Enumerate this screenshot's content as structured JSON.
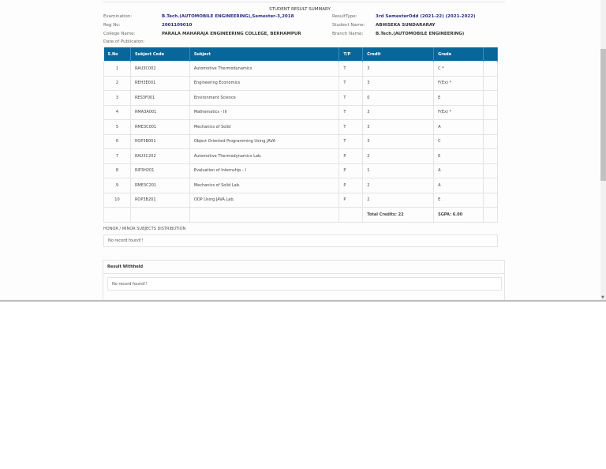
{
  "title": "STUDENT RESULT SUMMARY",
  "info": {
    "exam_label": "Examination:",
    "exam_value": "B.Tech.(AUTOMOBILE ENGINEERING),Semester-3,2018",
    "reg_label": "Reg No:",
    "reg_value": "2001109010",
    "college_label": "College Name:",
    "college_value": "PARALA MAHARAJA ENGINEERING COLLEGE, BERHAMPUR",
    "date_label": "Date of Publicaton:",
    "result_type_label": "ResultType:",
    "result_type_value": "3rd SemesterOdd (2021-22) (2021-2022)",
    "student_label": "Student Name:",
    "student_value": "ABHISEKA SUNDARARAY",
    "branch_label": "Branch Name:",
    "branch_value": "B.Tech.(AUTOMOBILE ENGINEERING)"
  },
  "table": {
    "headers": [
      "S.No",
      "Subject Code",
      "Subject",
      "T/P",
      "Credit",
      "Grade"
    ],
    "rows": [
      [
        "1",
        "RAU3C002",
        "Automotive Thermodynamics",
        "T",
        "3",
        "C *"
      ],
      [
        "2",
        "REH3E001",
        "Engineering Economics",
        "T",
        "3",
        "F(Ex) *"
      ],
      [
        "3",
        "RES3F001",
        "Environment Science",
        "T",
        "0",
        "E"
      ],
      [
        "4",
        "RMA3A001",
        "Mathematics - III",
        "T",
        "3",
        "F(Ex) *"
      ],
      [
        "5",
        "RME3C001",
        "Mechanics of Solid",
        "T",
        "3",
        "A"
      ],
      [
        "6",
        "ROP3B001",
        "Object Oriented Programming Using JAVA",
        "T",
        "3",
        "C"
      ],
      [
        "7",
        "RAU3C202",
        "Automotive Thermodynamics Lab.",
        "P",
        "2",
        "E"
      ],
      [
        "8",
        "RIP3H201",
        "Evaluation of Internship - I",
        "P",
        "1",
        "A"
      ],
      [
        "9",
        "RME3C201",
        "Mechanics of Solid Lab.",
        "P",
        "2",
        "A"
      ],
      [
        "10",
        "ROP3B201",
        "OOP Using JAVA Lab.",
        "P",
        "2",
        "E"
      ]
    ],
    "total_credits": "Total Credits: 22",
    "sgpa": "SGPA: 6.00"
  },
  "honor": {
    "heading": "HONOR / MINOR SUBJECTS DISTRIBUTION",
    "empty": "No record found!!"
  },
  "withheld": {
    "heading": "Result Withheld",
    "empty": "No record found!!"
  },
  "scrollbar": {
    "arrow": "▼"
  }
}
